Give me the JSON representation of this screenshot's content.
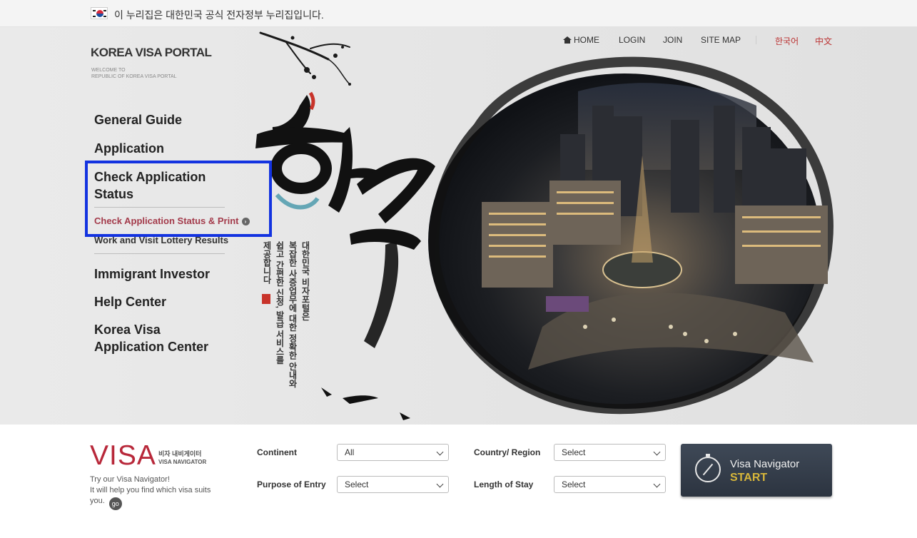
{
  "gov_banner": {
    "text": "이 누리집은 대한민국 공식 전자정부 누리집입니다."
  },
  "header": {
    "logo_title": "KOREA VISA PORTAL",
    "logo_sub_1": "WELCOME TO",
    "logo_sub_2": "REPUBLIC OF KOREA VISA PORTAL",
    "top_nav": {
      "home": "HOME",
      "login": "LOGIN",
      "join": "JOIN",
      "sitemap": "SITE MAP",
      "korean": "한국어",
      "chinese": "中文"
    }
  },
  "left_nav": {
    "general_guide": "General Guide",
    "application": "Application",
    "check_status_1": "Check Application",
    "check_status_2": "Status",
    "sub_check_print": "Check Application Status & Print",
    "sub_lottery": "Work and Visit Lottery Results",
    "immigrant_investor": "Immigrant Investor",
    "help_center": "Help Center",
    "kvac_1": "Korea Visa",
    "kvac_2": "Application Center"
  },
  "hero": {
    "calligraphy": "한국",
    "vertical_lines": [
      "대한민국 비자포털은",
      "복잡한 사증업무에 대한 정확한 안내와",
      "쉽고 간편한 신청, 발급 서비스를",
      "제공합니다"
    ],
    "seal": "印"
  },
  "navigator": {
    "logo": "VISA",
    "logo_kr": "비자 내비게이터",
    "logo_en": "VISA NAVIGATOR",
    "desc_1": "Try our Visa Navigator!",
    "desc_2": "It will help you find which visa suits",
    "desc_3": "you.",
    "go": "go",
    "continent_label": "Continent",
    "continent_value": "All",
    "country_label": "Country/ Region",
    "country_value": "Select",
    "purpose_label": "Purpose of Entry",
    "purpose_value": "Select",
    "length_label": "Length of Stay",
    "length_value": "Select",
    "start_line1": "Visa Navigator",
    "start_line2": "START"
  },
  "colors": {
    "highlight_border": "#1333e0",
    "brand_red": "#b8283a",
    "start_gold": "#d7b63a"
  }
}
